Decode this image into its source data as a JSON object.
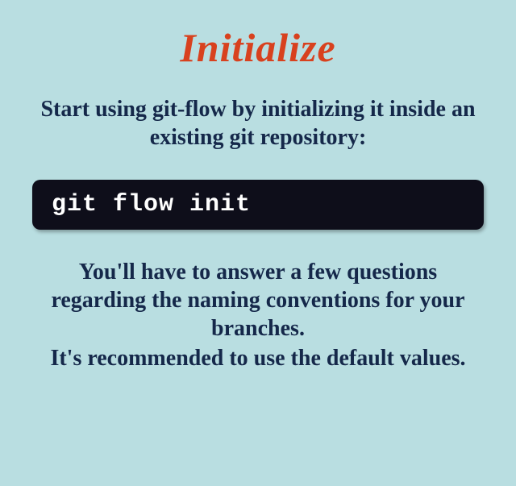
{
  "heading": "Initialize",
  "intro": "Start using git-flow by initializing it inside an existing git repository:",
  "code": "git flow init",
  "body_line1": "You'll have to answer a few questions regarding the naming conventions for your branches.",
  "body_line2": "It's recommended to use the default values."
}
